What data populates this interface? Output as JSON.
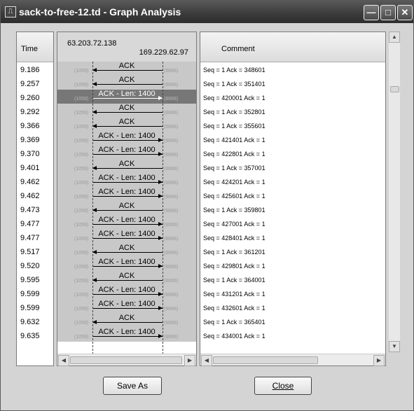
{
  "window": {
    "title": "sack-to-free-12.td - Graph Analysis",
    "app_icon": "⎍",
    "min": "—",
    "max": "□",
    "close": "✕"
  },
  "time_header": "Time",
  "graph_header": {
    "left_ip": "63.203.72.138",
    "right_ip": "169.229.62.97"
  },
  "comment_header": "Comment",
  "highlight_row": 2,
  "rows": [
    {
      "time": "9.186",
      "label": "ACK",
      "dir": "left",
      "lport": "(1059)",
      "rport": "(6666)",
      "comment": "Seq = 1 Ack = 348601"
    },
    {
      "time": "9.257",
      "label": "ACK",
      "dir": "left",
      "lport": "(1059)",
      "rport": "(6666)",
      "comment": "Seq = 1 Ack = 351401"
    },
    {
      "time": "9.260",
      "label": "ACK - Len: 1400",
      "dir": "right",
      "lport": "(1059)",
      "rport": "(6666)",
      "comment": "Seq = 420001 Ack = 1"
    },
    {
      "time": "9.292",
      "label": "ACK",
      "dir": "left",
      "lport": "(1059)",
      "rport": "(6666)",
      "comment": "Seq = 1 Ack = 352801"
    },
    {
      "time": "9.366",
      "label": "ACK",
      "dir": "left",
      "lport": "(1059)",
      "rport": "(6666)",
      "comment": "Seq = 1 Ack = 355601"
    },
    {
      "time": "9.369",
      "label": "ACK - Len: 1400",
      "dir": "right",
      "lport": "(1059)",
      "rport": "(6666)",
      "comment": "Seq = 421401 Ack = 1"
    },
    {
      "time": "9.370",
      "label": "ACK - Len: 1400",
      "dir": "right",
      "lport": "(1059)",
      "rport": "(6666)",
      "comment": "Seq = 422801 Ack = 1"
    },
    {
      "time": "9.401",
      "label": "ACK",
      "dir": "left",
      "lport": "(1059)",
      "rport": "(6666)",
      "comment": "Seq = 1 Ack = 357001"
    },
    {
      "time": "9.462",
      "label": "ACK - Len: 1400",
      "dir": "right",
      "lport": "(1059)",
      "rport": "(6666)",
      "comment": "Seq = 424201 Ack = 1"
    },
    {
      "time": "9.462",
      "label": "ACK - Len: 1400",
      "dir": "right",
      "lport": "(1059)",
      "rport": "(6666)",
      "comment": "Seq = 425601 Ack = 1"
    },
    {
      "time": "9.473",
      "label": "ACK",
      "dir": "left",
      "lport": "(1059)",
      "rport": "(6666)",
      "comment": "Seq = 1 Ack = 359801"
    },
    {
      "time": "9.477",
      "label": "ACK - Len: 1400",
      "dir": "right",
      "lport": "(1059)",
      "rport": "(6666)",
      "comment": "Seq = 427001 Ack = 1"
    },
    {
      "time": "9.477",
      "label": "ACK - Len: 1400",
      "dir": "right",
      "lport": "(1059)",
      "rport": "(6666)",
      "comment": "Seq = 428401 Ack = 1"
    },
    {
      "time": "9.517",
      "label": "ACK",
      "dir": "left",
      "lport": "(1059)",
      "rport": "(6666)",
      "comment": "Seq = 1 Ack = 361201"
    },
    {
      "time": "9.520",
      "label": "ACK - Len: 1400",
      "dir": "right",
      "lport": "(1059)",
      "rport": "(6666)",
      "comment": "Seq = 429801 Ack = 1"
    },
    {
      "time": "9.595",
      "label": "ACK",
      "dir": "left",
      "lport": "(1059)",
      "rport": "(6666)",
      "comment": "Seq = 1 Ack = 364001"
    },
    {
      "time": "9.599",
      "label": "ACK - Len: 1400",
      "dir": "right",
      "lport": "(1059)",
      "rport": "(6666)",
      "comment": "Seq = 431201 Ack = 1"
    },
    {
      "time": "9.599",
      "label": "ACK - Len: 1400",
      "dir": "right",
      "lport": "(1059)",
      "rport": "(6666)",
      "comment": "Seq = 432601 Ack = 1"
    },
    {
      "time": "9.632",
      "label": "ACK",
      "dir": "left",
      "lport": "(1059)",
      "rport": "(6666)",
      "comment": "Seq = 1 Ack = 365401"
    },
    {
      "time": "9.635",
      "label": "ACK - Len: 1400",
      "dir": "right",
      "lport": "(1059)",
      "rport": "(6666)",
      "comment": "Seq = 434001 Ack = 1"
    }
  ],
  "scroll": {
    "left": "◀",
    "right": "▶",
    "up": "▲",
    "down": "▼"
  },
  "buttons": {
    "save_as": "Save As",
    "close": "Close"
  }
}
